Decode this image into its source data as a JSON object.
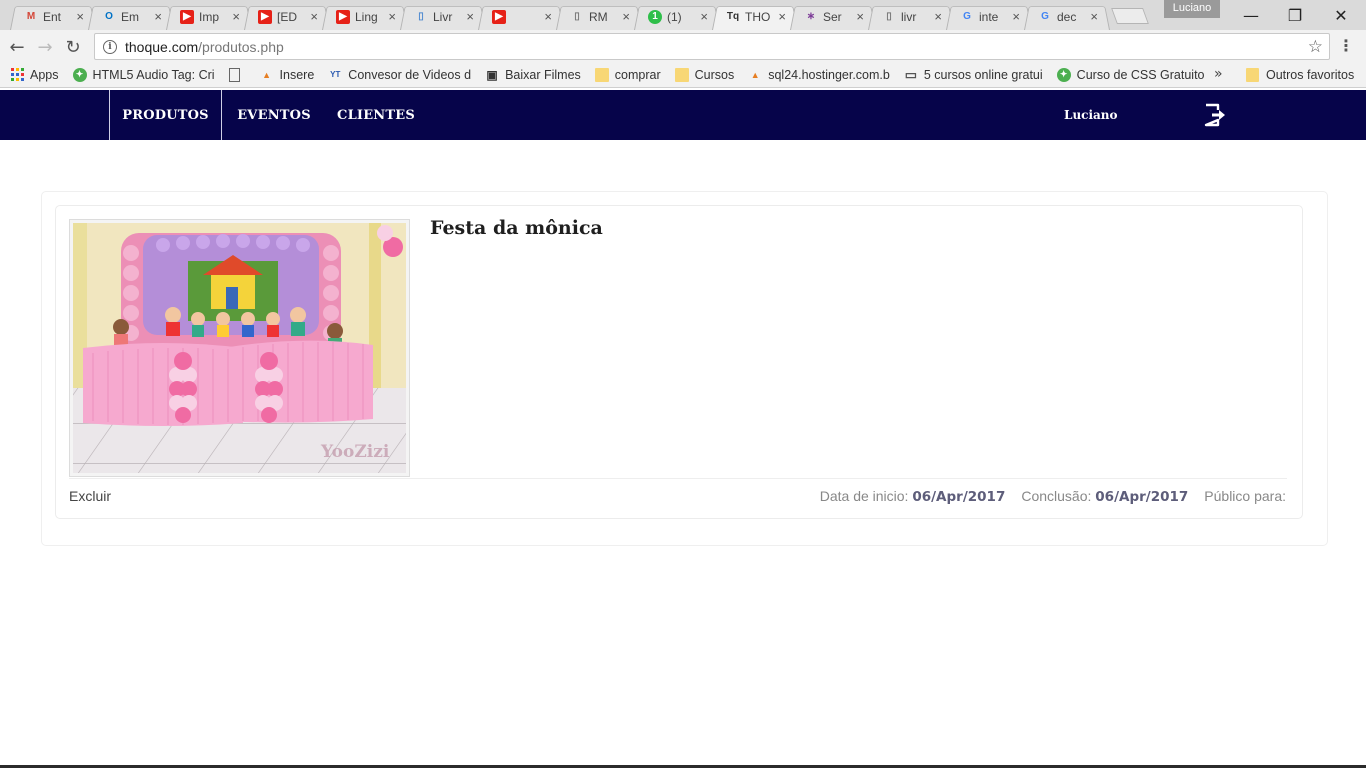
{
  "browser": {
    "tabs": [
      {
        "label": "Ent",
        "icon": "gmail-icon",
        "color": "#d44638"
      },
      {
        "label": "Em",
        "icon": "outlook-icon",
        "color": "#0072c6"
      },
      {
        "label": "Imp",
        "icon": "youtube-icon",
        "color": "#e62117"
      },
      {
        "label": "[ED",
        "icon": "youtube-icon",
        "color": "#e62117"
      },
      {
        "label": "Ling",
        "icon": "youtube-icon",
        "color": "#e62117"
      },
      {
        "label": "Livr",
        "icon": "book-icon",
        "color": "#4e8ad0"
      },
      {
        "label": "",
        "icon": "youtube-audio-icon",
        "color": "#e62117"
      },
      {
        "label": "RM",
        "icon": "page-icon",
        "color": "#777777"
      },
      {
        "label": "(1)",
        "icon": "whatsapp-icon",
        "color": "#2fbf4a"
      },
      {
        "label": "THO",
        "icon": "tq-icon",
        "color": "#333333"
      },
      {
        "label": "Ser",
        "icon": "slack-icon",
        "color": "#7d3c98"
      },
      {
        "label": "livr",
        "icon": "page-icon",
        "color": "#777777"
      },
      {
        "label": "inte",
        "icon": "google-icon",
        "color": "#4285f4"
      },
      {
        "label": "dec",
        "icon": "google-icon",
        "color": "#4285f4"
      }
    ],
    "active_tab": 9,
    "profile_name": "Luciano",
    "url_host": "thoque.com",
    "url_path": "/produtos.php",
    "bookmarks": [
      {
        "label": "Apps",
        "icon": "apps-icon"
      },
      {
        "label": "HTML5 Audio Tag: Cri",
        "icon": "green-leaf-icon"
      },
      {
        "label": "",
        "icon": "page-icon"
      },
      {
        "label": "Insere",
        "icon": "pma-icon"
      },
      {
        "label": "Convesor de Videos d",
        "icon": "yt-mp3-icon"
      },
      {
        "label": "Baixar Filmes",
        "icon": "clapper-icon"
      },
      {
        "label": "comprar",
        "icon": "folder-icon"
      },
      {
        "label": "Cursos",
        "icon": "folder-icon"
      },
      {
        "label": "sql24.hostinger.com.b",
        "icon": "pma-icon"
      },
      {
        "label": "5 cursos online gratui",
        "icon": "monitor-icon"
      },
      {
        "label": "Curso de CSS Gratuito",
        "icon": "green-leaf-icon"
      }
    ],
    "other_bookmarks": "Outros favoritos"
  },
  "site": {
    "nav": {
      "products": "PRODUTOS",
      "events": "EVENTOS",
      "clients": "CLIENTES"
    },
    "username": "Luciano",
    "brand_color": "#06044a"
  },
  "event": {
    "title": "Festa da mônica",
    "delete_label": "Excluir",
    "start_label": "Data de inicio:",
    "start_date": "06/Apr/2017",
    "end_label": "Conclusão:",
    "end_date": "06/Apr/2017",
    "audience_label": "Público para:",
    "photo_watermark": "YooZizi"
  }
}
